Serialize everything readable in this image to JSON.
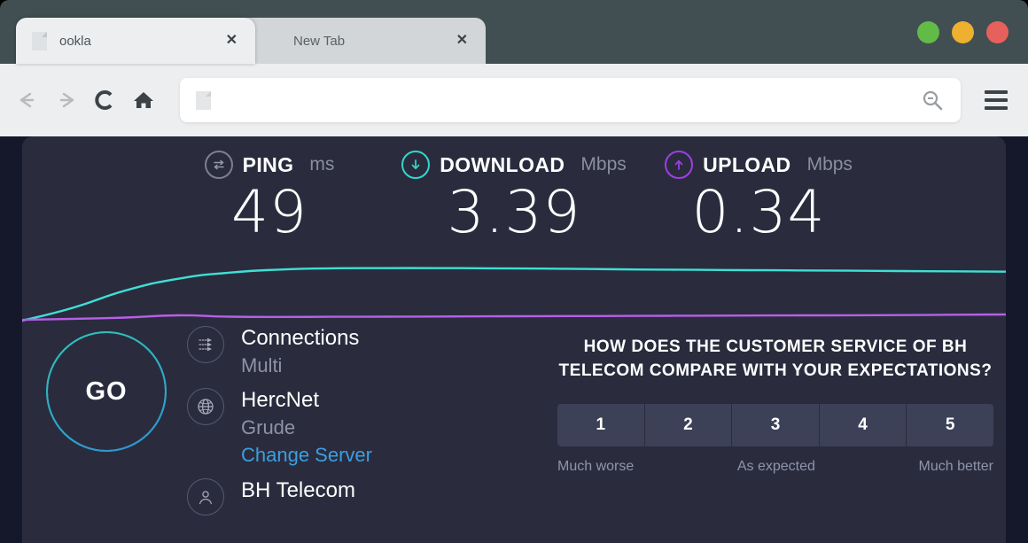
{
  "browser": {
    "tabs": [
      {
        "title": "ookla",
        "close_label": "✕",
        "active": true
      },
      {
        "title": "New Tab",
        "close_label": "✕",
        "active": false
      }
    ],
    "window_controls": [
      {
        "name": "minimize",
        "color": "#62bb46"
      },
      {
        "name": "maximize",
        "color": "#eeb02e"
      },
      {
        "name": "close",
        "color": "#e7615c"
      }
    ],
    "toolbar": {
      "back_icon": "back-arrow-icon",
      "forward_icon": "forward-arrow-icon",
      "reload_icon": "reload-icon",
      "home_icon": "home-icon",
      "search_icon": "search-icon",
      "menu_icon": "hamburger-menu-icon",
      "url_value": "",
      "url_placeholder": ""
    }
  },
  "speedtest": {
    "stats": [
      {
        "icon": "ping-icon",
        "label": "PING",
        "unit": "ms",
        "value": "49",
        "accent": "#7d8090"
      },
      {
        "icon": "download-icon",
        "label": "DOWNLOAD",
        "unit": "Mbps",
        "value": "3.39",
        "accent": "#34d7c8"
      },
      {
        "icon": "upload-icon",
        "label": "UPLOAD",
        "unit": "Mbps",
        "value": "0.34",
        "accent": "#a03ee8"
      }
    ],
    "go_button": "GO",
    "info": [
      {
        "icon": "connections-icon",
        "primary": "Connections",
        "secondary": "Multi",
        "link": ""
      },
      {
        "icon": "globe-icon",
        "primary": "HercNet",
        "secondary": "Grude",
        "link": "Change Server"
      },
      {
        "icon": "person-icon",
        "primary": "BH Telecom",
        "secondary": "",
        "link": ""
      }
    ],
    "survey": {
      "question": "HOW DOES THE CUSTOMER SERVICE OF BH TELECOM COMPARE WITH YOUR EXPECTATIONS?",
      "ratings": [
        "1",
        "2",
        "3",
        "4",
        "5"
      ],
      "scale_low": "Much worse",
      "scale_mid": "As expected",
      "scale_high": "Much better"
    }
  },
  "chart_data": {
    "type": "line",
    "title": "",
    "xlabel": "",
    "ylabel": "Mbps",
    "grid": false,
    "legend": "none",
    "series": [
      {
        "name": "download",
        "color": "#3ee0d4",
        "values": [
          0.0,
          0.85,
          1.95,
          2.7,
          3.1,
          3.3,
          3.38,
          3.39,
          3.39,
          3.38,
          3.36,
          3.33,
          3.3,
          3.28,
          3.26,
          3.24,
          3.22,
          3.2,
          3.18,
          3.16
        ]
      },
      {
        "name": "upload",
        "color": "#b85fe8",
        "values": [
          0.05,
          0.12,
          0.2,
          0.34,
          0.26,
          0.24,
          0.25,
          0.26,
          0.27,
          0.28,
          0.29,
          0.3,
          0.31,
          0.32,
          0.33,
          0.34,
          0.35,
          0.36,
          0.38,
          0.4
        ]
      }
    ],
    "ylim": [
      0,
      4.0
    ]
  }
}
